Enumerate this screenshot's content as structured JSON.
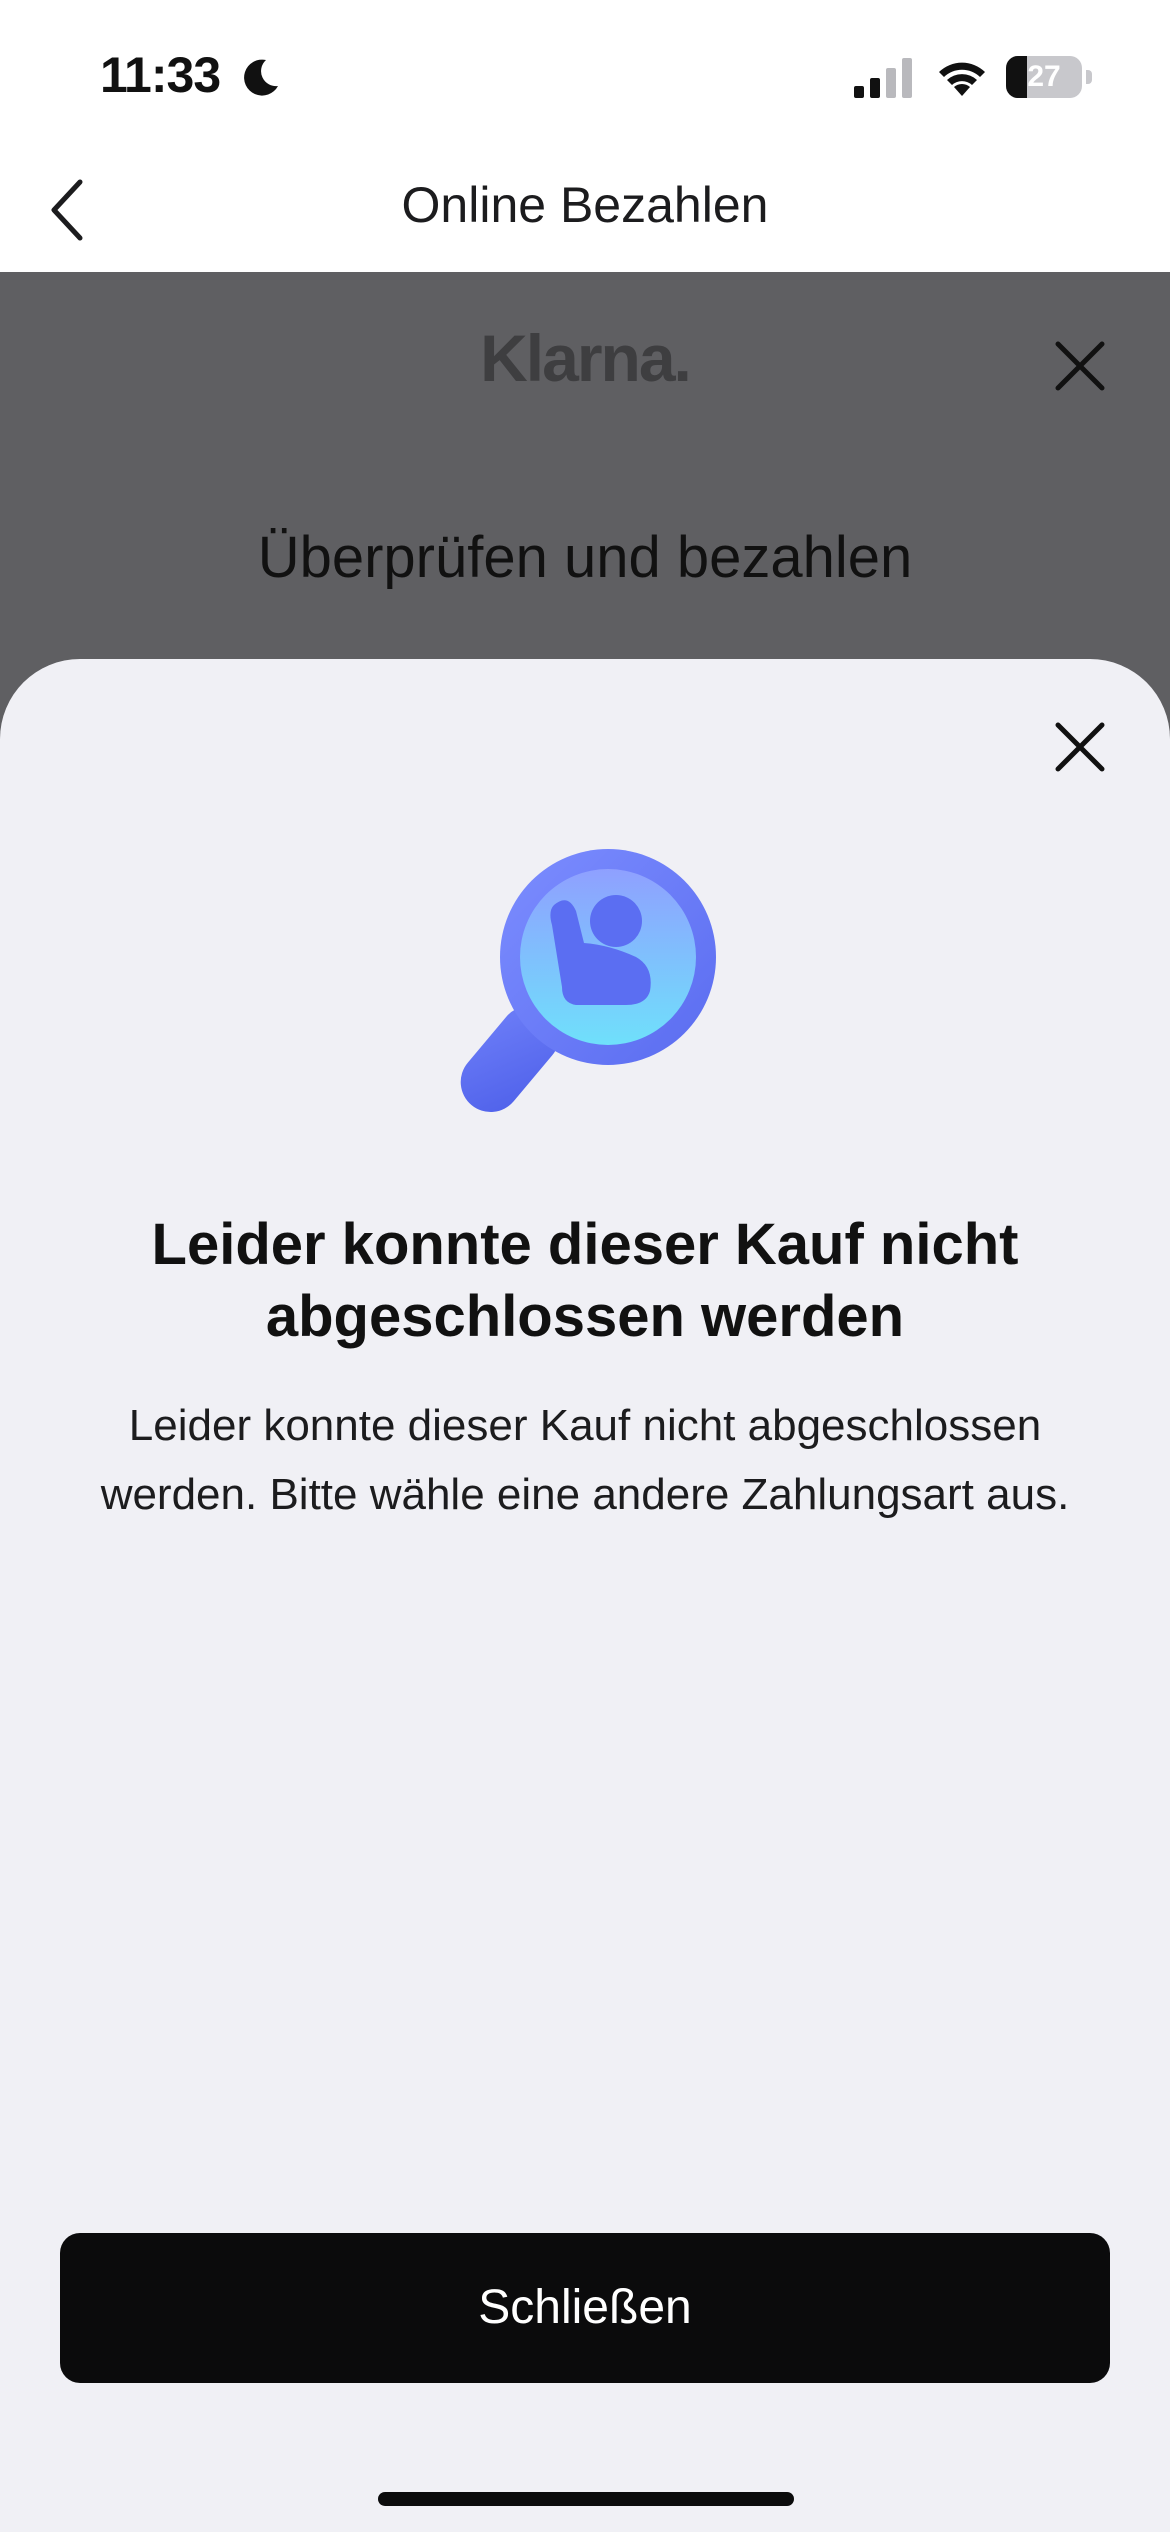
{
  "status_bar": {
    "time": "11:33",
    "battery_level": "27",
    "battery_fraction": 0.27,
    "icons": [
      "moon-icon",
      "signal-icon",
      "wifi-icon",
      "battery-icon"
    ]
  },
  "nav": {
    "title": "Online Bezahlen",
    "back_icon": "chevron-left-icon"
  },
  "klarna": {
    "logo_text": "Klarna.",
    "heading": "Überprüfen und bezahlen",
    "close_icon": "close-icon"
  },
  "sheet": {
    "close_icon": "close-icon",
    "illustration": "magnifier-person-icon",
    "title": "Leider konnte dieser Kauf nicht abgeschlossen werden",
    "body": "Leider konnte dieser Kauf nicht abgeschlossen werden. Bitte wähle eine andere Zahlungsart aus.",
    "button_label": "Schließen"
  },
  "colors": {
    "overlay": "#5f5f62",
    "sheet_bg": "#f0f0f5",
    "button_bg": "#0b0b0c",
    "button_text": "#ffffff",
    "illustration_ring": "#6b7cf6",
    "illustration_glass": "#7fd3fb"
  }
}
